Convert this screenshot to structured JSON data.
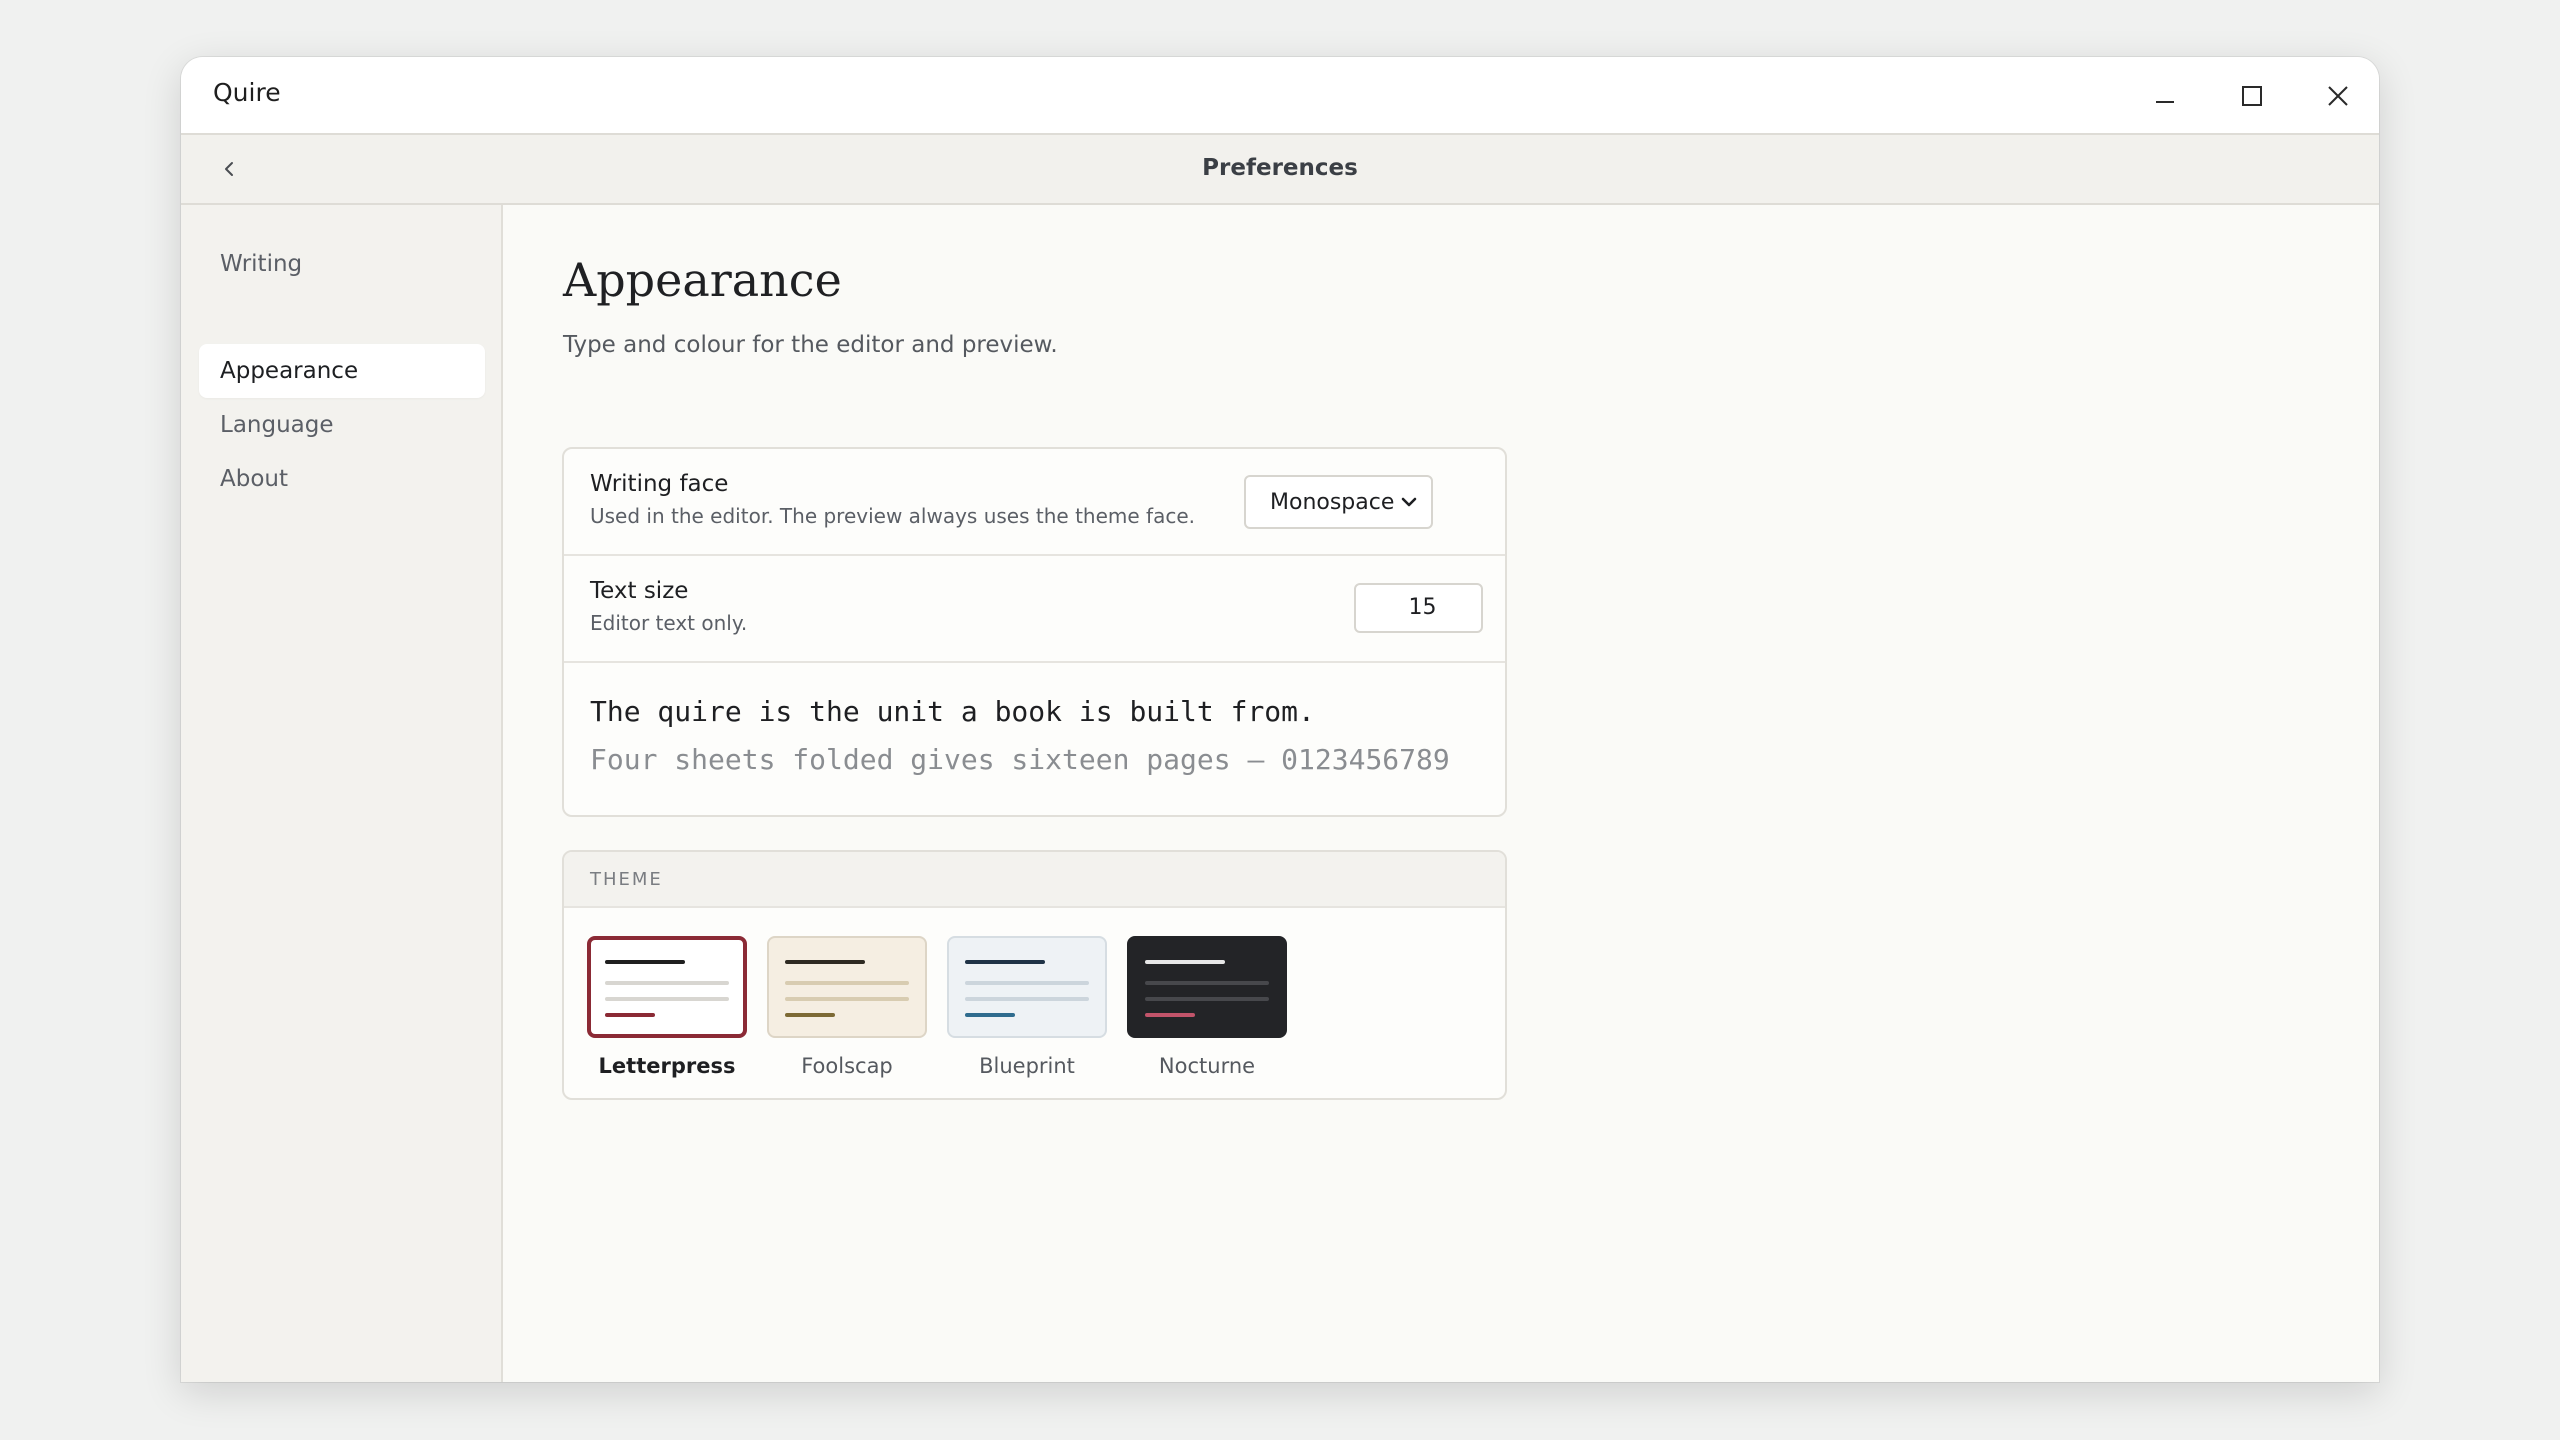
{
  "app": {
    "name": "Quire"
  },
  "window_controls": {
    "minimize_icon": "minimize-icon",
    "maximize_icon": "maximize-icon",
    "close_icon": "close-icon"
  },
  "header": {
    "back_icon": "chevron-left-icon",
    "title": "Preferences"
  },
  "sidebar": {
    "items": [
      {
        "label": "Writing",
        "active": false
      },
      {
        "label": "Appearance",
        "active": true
      },
      {
        "label": "Language",
        "active": false
      },
      {
        "label": "About",
        "active": false
      }
    ]
  },
  "page": {
    "title": "Appearance",
    "subtitle": "Type and colour for the editor and preview."
  },
  "settings": {
    "writing_face": {
      "label": "Writing face",
      "hint": "Used in the editor. The preview always uses the theme face.",
      "value": "Monospace"
    },
    "text_size": {
      "label": "Text size",
      "hint": "Editor text only.",
      "value": "15"
    },
    "preview": {
      "line1": "The quire is the unit a book is built from.",
      "line2": "Four sheets folded gives sixteen pages — 0123456789"
    }
  },
  "theme": {
    "heading": "THEME",
    "options": [
      {
        "name": "Letterpress",
        "selected": true,
        "bg": "#ffffff",
        "primary": "#1f1f1f",
        "secondary": "#d8d6d1",
        "accent": "#8b2a35",
        "border": "#8b2a35"
      },
      {
        "name": "Foolscap",
        "selected": false,
        "bg": "#f5eee2",
        "primary": "#2e2a22",
        "secondary": "#d8ccb1",
        "accent": "#7d6a35",
        "border": "#ddd5c6"
      },
      {
        "name": "Blueprint",
        "selected": false,
        "bg": "#eef2f5",
        "primary": "#1f3346",
        "secondary": "#ccd5dc",
        "accent": "#2f6c8e",
        "border": "#d6dde2"
      },
      {
        "name": "Nocturne",
        "selected": false,
        "bg": "#232427",
        "primary": "#e8e8e8",
        "secondary": "#47484c",
        "accent": "#c2546a",
        "border": "#232427"
      }
    ]
  }
}
